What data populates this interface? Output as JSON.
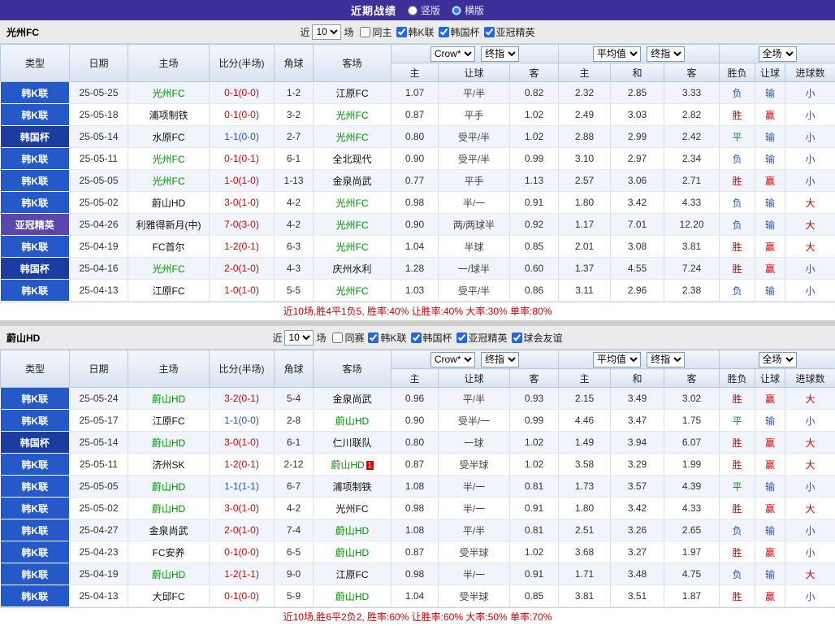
{
  "topbar": {
    "title": "近期战绩",
    "vertical": "竖版",
    "horizontal": "横版",
    "selected": "横版"
  },
  "colors": {
    "topbar_purple": "#3d2f99",
    "league_blue": "#2558c8",
    "cup_blue": "#1b3da2",
    "acl_purple": "#5a47ad",
    "win_red": "#dd0000",
    "loss_blue": "#2653cc",
    "draw_green": "#009933",
    "focal_team_green": "#009000",
    "summary_red": "#d40000"
  },
  "header": {
    "type": "类型",
    "date": "日期",
    "home": "主场",
    "score": "比分(半场)",
    "corner": "角球",
    "away": "客场",
    "h": "主",
    "handicap": "让球",
    "a": "客",
    "avg_h": "主",
    "avg_d": "和",
    "avg_a": "客",
    "wdl": "胜负",
    "hcap_res": "让球",
    "goals": "进球数"
  },
  "dropdowns": {
    "recent_count": "10",
    "bookmaker": "Crow*",
    "final": "终指",
    "average": "平均值",
    "final2": "终指",
    "full": "全场"
  },
  "filter": {
    "near": "近",
    "matches": "场"
  },
  "tables": [
    {
      "team": "光州FC",
      "filters": [
        {
          "label": "同主",
          "checked": false
        },
        {
          "label": "韩K联",
          "checked": true
        },
        {
          "label": "韩国杯",
          "checked": true
        },
        {
          "label": "亚冠精英",
          "checked": true
        }
      ],
      "rows": [
        {
          "type": "韩K联",
          "type_style": "k",
          "date": "25-05-25",
          "home": "光州FC",
          "home_focal": true,
          "score": "0-1(0-0)",
          "score_color": "r",
          "corner": "1-2",
          "away": "江原FC",
          "away_focal": false,
          "away_note": "",
          "odds": [
            "1.07",
            "平/半",
            "0.82"
          ],
          "avg": [
            "2.32",
            "2.85",
            "3.33"
          ],
          "results": [
            "负",
            "输",
            "小"
          ],
          "result_colors": [
            "b",
            "b",
            "b"
          ]
        },
        {
          "type": "韩K联",
          "type_style": "k",
          "date": "25-05-18",
          "home": "浦项制铁",
          "home_focal": false,
          "score": "0-1(0-0)",
          "score_color": "r",
          "corner": "3-2",
          "away": "光州FC",
          "away_focal": true,
          "away_note": "",
          "odds": [
            "0.87",
            "平手",
            "1.02"
          ],
          "avg": [
            "2.49",
            "3.03",
            "2.82"
          ],
          "results": [
            "胜",
            "赢",
            "小"
          ],
          "result_colors": [
            "r",
            "r",
            "b"
          ]
        },
        {
          "type": "韩国杯",
          "type_style": "c",
          "date": "25-05-14",
          "home": "水原FC",
          "home_focal": false,
          "score": "1-1(0-0)",
          "score_color": "b",
          "corner": "2-7",
          "away": "光州FC",
          "away_focal": true,
          "away_note": "",
          "odds": [
            "0.80",
            "受平/半",
            "1.02"
          ],
          "avg": [
            "2.88",
            "2.99",
            "2.42"
          ],
          "results": [
            "平",
            "输",
            "小"
          ],
          "result_colors": [
            "g",
            "b",
            "b"
          ]
        },
        {
          "type": "韩K联",
          "type_style": "k",
          "date": "25-05-11",
          "home": "光州FC",
          "home_focal": true,
          "score": "0-1(0-1)",
          "score_color": "r",
          "corner": "6-1",
          "away": "全北现代",
          "away_focal": false,
          "away_note": "",
          "odds": [
            "0.90",
            "受平/半",
            "0.99"
          ],
          "avg": [
            "3.10",
            "2.97",
            "2.34"
          ],
          "results": [
            "负",
            "输",
            "小"
          ],
          "result_colors": [
            "b",
            "b",
            "b"
          ]
        },
        {
          "type": "韩K联",
          "type_style": "k",
          "date": "25-05-05",
          "home": "光州FC",
          "home_focal": true,
          "score": "1-0(1-0)",
          "score_color": "r",
          "corner": "1-13",
          "away": "金泉尚武",
          "away_focal": false,
          "away_note": "",
          "odds": [
            "0.77",
            "平手",
            "1.13"
          ],
          "avg": [
            "2.57",
            "3.06",
            "2.71"
          ],
          "results": [
            "胜",
            "赢",
            "小"
          ],
          "result_colors": [
            "r",
            "r",
            "b"
          ]
        },
        {
          "type": "韩K联",
          "type_style": "k",
          "date": "25-05-02",
          "home": "蔚山HD",
          "home_focal": false,
          "score": "3-0(1-0)",
          "score_color": "r",
          "corner": "4-2",
          "away": "光州FC",
          "away_focal": true,
          "away_note": "",
          "odds": [
            "0.98",
            "半/一",
            "0.91"
          ],
          "avg": [
            "1.80",
            "3.42",
            "4.33"
          ],
          "results": [
            "负",
            "输",
            "大"
          ],
          "result_colors": [
            "b",
            "b",
            "r"
          ]
        },
        {
          "type": "亚冠精英",
          "type_style": "a",
          "date": "25-04-26",
          "home": "利雅得新月(中)",
          "home_focal": false,
          "score": "7-0(3-0)",
          "score_color": "r",
          "corner": "4-2",
          "away": "光州FC",
          "away_focal": true,
          "away_note": "",
          "odds": [
            "0.90",
            "两/两球半",
            "0.92"
          ],
          "avg": [
            "1.17",
            "7.01",
            "12.20"
          ],
          "results": [
            "负",
            "输",
            "大"
          ],
          "result_colors": [
            "b",
            "b",
            "r"
          ]
        },
        {
          "type": "韩K联",
          "type_style": "k",
          "date": "25-04-19",
          "home": "FC首尔",
          "home_focal": false,
          "score": "1-2(0-1)",
          "score_color": "r",
          "corner": "6-3",
          "away": "光州FC",
          "away_focal": true,
          "away_note": "",
          "odds": [
            "1.04",
            "半球",
            "0.85"
          ],
          "avg": [
            "2.01",
            "3.08",
            "3.81"
          ],
          "results": [
            "胜",
            "赢",
            "大"
          ],
          "result_colors": [
            "r",
            "r",
            "r"
          ]
        },
        {
          "type": "韩国杯",
          "type_style": "c",
          "date": "25-04-16",
          "home": "光州FC",
          "home_focal": true,
          "score": "2-0(1-0)",
          "score_color": "r",
          "corner": "4-3",
          "away": "庆州水利",
          "away_focal": false,
          "away_note": "",
          "odds": [
            "1.28",
            "一/球半",
            "0.60"
          ],
          "avg": [
            "1.37",
            "4.55",
            "7.24"
          ],
          "results": [
            "胜",
            "赢",
            "小"
          ],
          "result_colors": [
            "r",
            "r",
            "b"
          ]
        },
        {
          "type": "韩K联",
          "type_style": "k",
          "date": "25-04-13",
          "home": "江原FC",
          "home_focal": false,
          "score": "1-0(1-0)",
          "score_color": "r",
          "corner": "5-5",
          "away": "光州FC",
          "away_focal": true,
          "away_note": "",
          "odds": [
            "1.03",
            "受平/半",
            "0.86"
          ],
          "avg": [
            "3.11",
            "2.96",
            "2.38"
          ],
          "results": [
            "负",
            "输",
            "小"
          ],
          "result_colors": [
            "b",
            "b",
            "b"
          ]
        }
      ],
      "summary": "近10场,胜4平1负5, 胜率:40% 让胜率:40% 大率:30% 单率:80%"
    },
    {
      "team": "蔚山HD",
      "filters": [
        {
          "label": "同赛",
          "checked": false
        },
        {
          "label": "韩K联",
          "checked": true
        },
        {
          "label": "韩国杯",
          "checked": true
        },
        {
          "label": "亚冠精英",
          "checked": true
        },
        {
          "label": "球会友谊",
          "checked": true
        }
      ],
      "rows": [
        {
          "type": "韩K联",
          "type_style": "k",
          "date": "25-05-24",
          "home": "蔚山HD",
          "home_focal": true,
          "score": "3-2(0-1)",
          "score_color": "r",
          "corner": "5-4",
          "away": "金泉尚武",
          "away_focal": false,
          "away_note": "",
          "odds": [
            "0.96",
            "平/半",
            "0.93"
          ],
          "avg": [
            "2.15",
            "3.49",
            "3.02"
          ],
          "results": [
            "胜",
            "赢",
            "大"
          ],
          "result_colors": [
            "r",
            "r",
            "r"
          ]
        },
        {
          "type": "韩K联",
          "type_style": "k",
          "date": "25-05-17",
          "home": "江原FC",
          "home_focal": false,
          "score": "1-1(0-0)",
          "score_color": "b",
          "corner": "2-8",
          "away": "蔚山HD",
          "away_focal": true,
          "away_note": "",
          "odds": [
            "0.90",
            "受半/一",
            "0.99"
          ],
          "avg": [
            "4.46",
            "3.47",
            "1.75"
          ],
          "results": [
            "平",
            "输",
            "小"
          ],
          "result_colors": [
            "g",
            "b",
            "b"
          ]
        },
        {
          "type": "韩国杯",
          "type_style": "c",
          "date": "25-05-14",
          "home": "蔚山HD",
          "home_focal": true,
          "score": "3-0(1-0)",
          "score_color": "r",
          "corner": "6-1",
          "away": "仁川联队",
          "away_focal": false,
          "away_note": "",
          "odds": [
            "0.80",
            "一球",
            "1.02"
          ],
          "avg": [
            "1.49",
            "3.94",
            "6.07"
          ],
          "results": [
            "胜",
            "赢",
            "大"
          ],
          "result_colors": [
            "r",
            "r",
            "r"
          ]
        },
        {
          "type": "韩K联",
          "type_style": "k",
          "date": "25-05-11",
          "home": "济州SK",
          "home_focal": false,
          "score": "1-2(0-1)",
          "score_color": "r",
          "corner": "2-12",
          "away": "蔚山HD",
          "away_focal": true,
          "away_note": "1",
          "odds": [
            "0.87",
            "受半球",
            "1.02"
          ],
          "avg": [
            "3.58",
            "3.29",
            "1.99"
          ],
          "results": [
            "胜",
            "赢",
            "大"
          ],
          "result_colors": [
            "r",
            "r",
            "r"
          ]
        },
        {
          "type": "韩K联",
          "type_style": "k",
          "date": "25-05-05",
          "home": "蔚山HD",
          "home_focal": true,
          "score": "1-1(1-1)",
          "score_color": "b",
          "corner": "6-7",
          "away": "浦项制铁",
          "away_focal": false,
          "away_note": "",
          "odds": [
            "1.08",
            "半/一",
            "0.81"
          ],
          "avg": [
            "1.73",
            "3.57",
            "4.39"
          ],
          "results": [
            "平",
            "输",
            "小"
          ],
          "result_colors": [
            "g",
            "b",
            "b"
          ]
        },
        {
          "type": "韩K联",
          "type_style": "k",
          "date": "25-05-02",
          "home": "蔚山HD",
          "home_focal": true,
          "score": "3-0(1-0)",
          "score_color": "r",
          "corner": "4-2",
          "away": "光州FC",
          "away_focal": false,
          "away_note": "",
          "odds": [
            "0.98",
            "半/一",
            "0.91"
          ],
          "avg": [
            "1.80",
            "3.42",
            "4.33"
          ],
          "results": [
            "胜",
            "赢",
            "大"
          ],
          "result_colors": [
            "r",
            "r",
            "r"
          ]
        },
        {
          "type": "韩K联",
          "type_style": "k",
          "date": "25-04-27",
          "home": "金泉尚武",
          "home_focal": false,
          "score": "2-0(1-0)",
          "score_color": "r",
          "corner": "7-4",
          "away": "蔚山HD",
          "away_focal": true,
          "away_note": "",
          "odds": [
            "1.08",
            "平/半",
            "0.81"
          ],
          "avg": [
            "2.51",
            "3.26",
            "2.65"
          ],
          "results": [
            "负",
            "输",
            "小"
          ],
          "result_colors": [
            "b",
            "b",
            "b"
          ]
        },
        {
          "type": "韩K联",
          "type_style": "k",
          "date": "25-04-23",
          "home": "FC安养",
          "home_focal": false,
          "score": "0-1(0-0)",
          "score_color": "r",
          "corner": "6-5",
          "away": "蔚山HD",
          "away_focal": true,
          "away_note": "",
          "odds": [
            "0.87",
            "受半球",
            "1.02"
          ],
          "avg": [
            "3.68",
            "3.27",
            "1.97"
          ],
          "results": [
            "胜",
            "赢",
            "小"
          ],
          "result_colors": [
            "r",
            "r",
            "b"
          ]
        },
        {
          "type": "韩K联",
          "type_style": "k",
          "date": "25-04-19",
          "home": "蔚山HD",
          "home_focal": true,
          "score": "1-2(1-1)",
          "score_color": "r",
          "corner": "9-0",
          "away": "江原FC",
          "away_focal": false,
          "away_note": "",
          "odds": [
            "0.98",
            "半/一",
            "0.91"
          ],
          "avg": [
            "1.71",
            "3.48",
            "4.75"
          ],
          "results": [
            "负",
            "输",
            "大"
          ],
          "result_colors": [
            "b",
            "b",
            "r"
          ]
        },
        {
          "type": "韩K联",
          "type_style": "k",
          "date": "25-04-13",
          "home": "大邱FC",
          "home_focal": false,
          "score": "0-1(0-0)",
          "score_color": "r",
          "corner": "5-9",
          "away": "蔚山HD",
          "away_focal": true,
          "away_note": "",
          "odds": [
            "1.04",
            "受半球",
            "0.85"
          ],
          "avg": [
            "3.81",
            "3.51",
            "1.87"
          ],
          "results": [
            "胜",
            "赢",
            "小"
          ],
          "result_colors": [
            "r",
            "r",
            "b"
          ]
        }
      ],
      "summary": "近10场,胜6平2负2, 胜率:60% 让胜率:60% 大率:50% 单率:70%"
    }
  ]
}
